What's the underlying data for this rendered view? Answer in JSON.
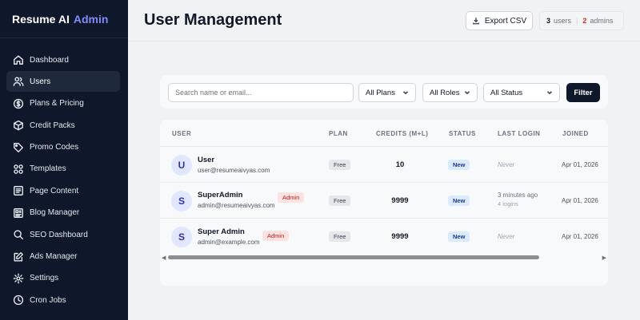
{
  "brand": {
    "name": "Resume AI",
    "suffix": "Admin"
  },
  "sidebar": {
    "items": [
      {
        "label": "Dashboard",
        "icon": "home-icon",
        "active": false
      },
      {
        "label": "Users",
        "icon": "users-icon",
        "active": true
      },
      {
        "label": "Plans & Pricing",
        "icon": "dollar-icon",
        "active": false
      },
      {
        "label": "Credit Packs",
        "icon": "box-icon",
        "active": false
      },
      {
        "label": "Promo Codes",
        "icon": "tag-icon",
        "active": false
      },
      {
        "label": "Templates",
        "icon": "grid-icon",
        "active": false
      },
      {
        "label": "Page Content",
        "icon": "page-icon",
        "active": false
      },
      {
        "label": "Blog Manager",
        "icon": "blog-icon",
        "active": false
      },
      {
        "label": "SEO Dashboard",
        "icon": "search-icon",
        "active": false
      },
      {
        "label": "Ads Manager",
        "icon": "edit-icon",
        "active": false
      },
      {
        "label": "Settings",
        "icon": "gear-icon",
        "active": false
      },
      {
        "label": "Cron Jobs",
        "icon": "clock-icon",
        "active": false
      }
    ]
  },
  "header": {
    "title": "User Management",
    "export_label": "Export CSV",
    "users_count": "3",
    "users_label": "users",
    "admins_count": "2",
    "admins_label": "admins"
  },
  "filters": {
    "search_placeholder": "Search name or email...",
    "plans": "All Plans",
    "roles": "All Roles",
    "status": "All Status",
    "button": "Filter"
  },
  "table": {
    "headers": {
      "user": "USER",
      "plan": "PLAN",
      "credits": "CREDITS (M+L)",
      "status": "STATUS",
      "last_login": "LAST LOGIN",
      "joined": "JOINED"
    },
    "rows": [
      {
        "initial": "U",
        "name": "User",
        "email": "user@resumeaivyas.com",
        "role": "",
        "plan": "Free",
        "credits": "10",
        "status": "New",
        "last_login": "Never",
        "last_login_sub": "",
        "joined": "Apr 01, 2026"
      },
      {
        "initial": "S",
        "name": "SuperAdmin",
        "email": "admin@resumeaivyas.com",
        "role": "Admin",
        "plan": "Free",
        "credits": "9999",
        "status": "New",
        "last_login": "3 minutes ago",
        "last_login_sub": "4 logins",
        "joined": "Apr 01, 2026"
      },
      {
        "initial": "S",
        "name": "Super Admin",
        "email": "admin@example.com",
        "role": "Admin",
        "plan": "Free",
        "credits": "9999",
        "status": "New",
        "last_login": "Never",
        "last_login_sub": "",
        "joined": "Apr 01, 2026"
      }
    ],
    "scroll_fraction": 0.86
  },
  "colors": {
    "sidebar_bg": "#0f172a",
    "accent": "#818cf8",
    "admin_badge": "#fde2e2",
    "status_badge": "#dbeafe",
    "filter_button": "#0f172a"
  }
}
